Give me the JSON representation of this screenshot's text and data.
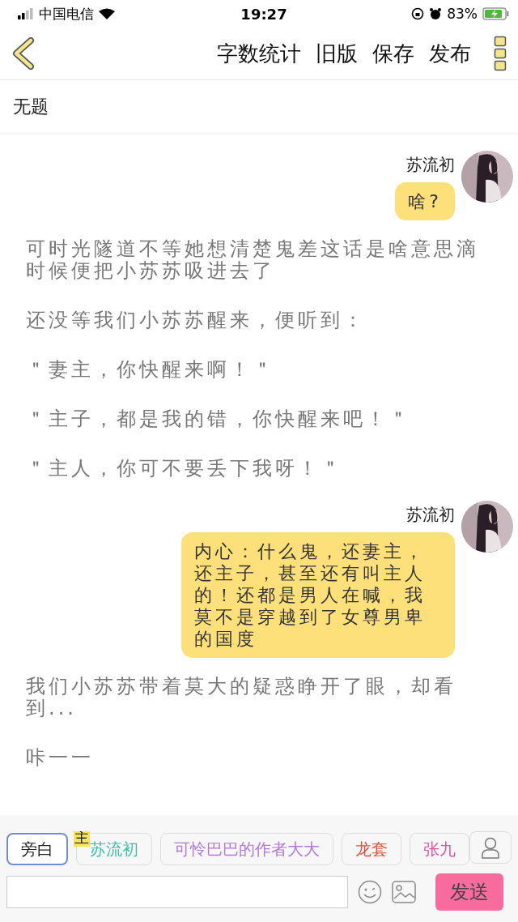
{
  "status_bar": {
    "carrier": "中国电信",
    "time": "19:27",
    "battery": "83%"
  },
  "nav": {
    "actions": [
      "字数统计",
      "旧版",
      "保存",
      "发布"
    ]
  },
  "title": "无题",
  "messages": [
    {
      "kind": "bubble",
      "speaker": "苏流初",
      "text": "啥?"
    },
    {
      "kind": "narration",
      "text": "可时光隧道不等她想清楚鬼差这话是啥意思滴时候便把小苏苏吸进去了"
    },
    {
      "kind": "narration",
      "text": "还没等我们小苏苏醒来，便听到："
    },
    {
      "kind": "narration",
      "text": "＂妻主，你快醒来啊！＂"
    },
    {
      "kind": "narration",
      "text": "＂主子，都是我的错，你快醒来吧！＂"
    },
    {
      "kind": "narration",
      "text": "＂主人，你可不要丢下我呀！＂"
    },
    {
      "kind": "bubble",
      "speaker": "苏流初",
      "text": "内心：什么鬼，还妻主，还主子，甚至还有叫主人的！还都是男人在喊，我莫不是穿越到了女尊男卑的国度"
    },
    {
      "kind": "narration",
      "text": "我们小苏苏带着莫大的疑惑睁开了眼，却看到..."
    },
    {
      "kind": "narration",
      "text": "咔一一"
    }
  ],
  "characters": [
    {
      "name": "旁白",
      "selected": true,
      "color": "#222222"
    },
    {
      "name": "苏流初",
      "selected": false,
      "color": "#3dbfa8",
      "badge": "主"
    },
    {
      "name": "可怜巴巴的作者大大",
      "selected": false,
      "color": "#b07ad6"
    },
    {
      "name": "龙套",
      "selected": false,
      "color": "#d9503c"
    },
    {
      "name": "张九",
      "selected": false,
      "color": "#d9559a"
    }
  ],
  "composer": {
    "send": "发送"
  }
}
